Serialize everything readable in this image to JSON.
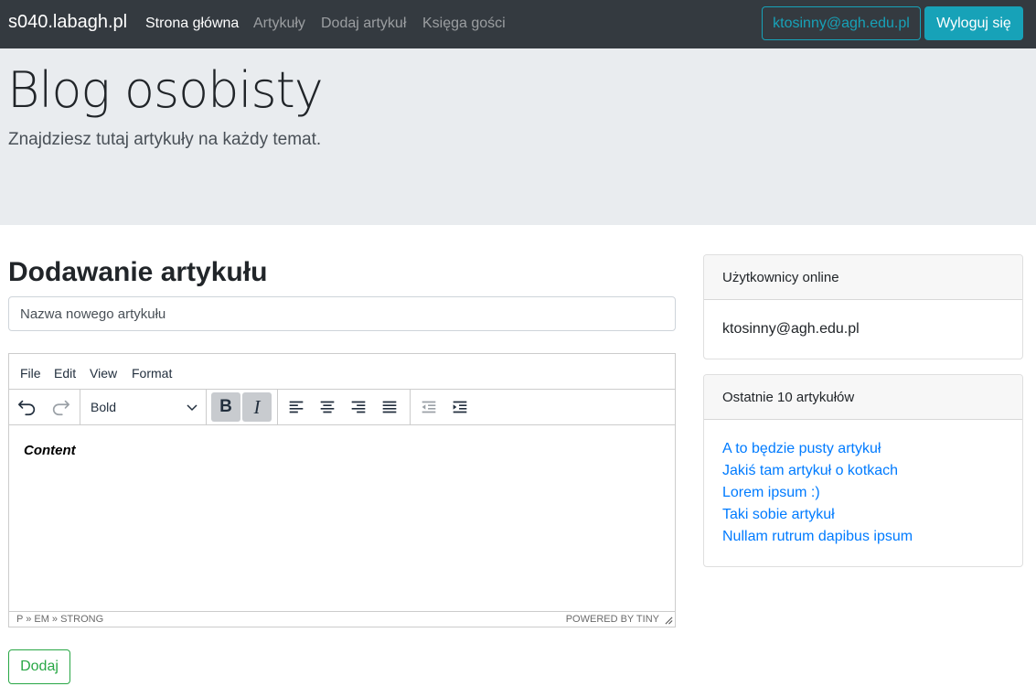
{
  "navbar": {
    "brand": "s040.labagh.pl",
    "links": [
      {
        "label": "Strona główna",
        "active": true
      },
      {
        "label": "Artykuły",
        "active": false
      },
      {
        "label": "Dodaj artykuł",
        "active": false
      },
      {
        "label": "Księga gości",
        "active": false
      }
    ],
    "user_email": "ktosinny@agh.edu.pl",
    "logout_label": "Wyloguj się"
  },
  "jumbotron": {
    "title": "Blog osobisty",
    "lead": "Znajdziesz tutaj artykuły na każdy temat."
  },
  "main": {
    "heading": "Dodawanie artykułu",
    "title_input": {
      "value": "",
      "placeholder": "Nazwa nowego artykułu"
    },
    "submit_label": "Dodaj"
  },
  "editor": {
    "menu": [
      "File",
      "Edit",
      "View",
      "Format"
    ],
    "block_format": "Bold",
    "toolbar_icons": [
      "undo-icon",
      "redo-icon",
      "bold-icon",
      "italic-icon",
      "align-left-icon",
      "align-center-icon",
      "align-right-icon",
      "align-justify-icon",
      "outdent-icon",
      "indent-icon"
    ],
    "bold_active": true,
    "italic_active": true,
    "bold_glyph": "B",
    "italic_glyph": "I",
    "content": "Content",
    "path": "P » EM » STRONG",
    "powered_by": "POWERED BY TINY"
  },
  "sidebar": {
    "online": {
      "header": "Użytkownicy online",
      "users": [
        "ktosinny@agh.edu.pl"
      ]
    },
    "recent": {
      "header": "Ostatnie 10 artykułów",
      "articles": [
        "A to będzie pusty artykuł",
        "Jakiś tam artykuł o kotkach",
        "Lorem ipsum :)",
        "Taki sobie artykuł",
        "Nullam rutrum dapibus ipsum"
      ]
    }
  },
  "colors": {
    "navbar_bg": "#343a40",
    "info": "#17a2b8",
    "success": "#28a745",
    "link": "#007bff",
    "jumbotron_bg": "#e9ecef"
  }
}
